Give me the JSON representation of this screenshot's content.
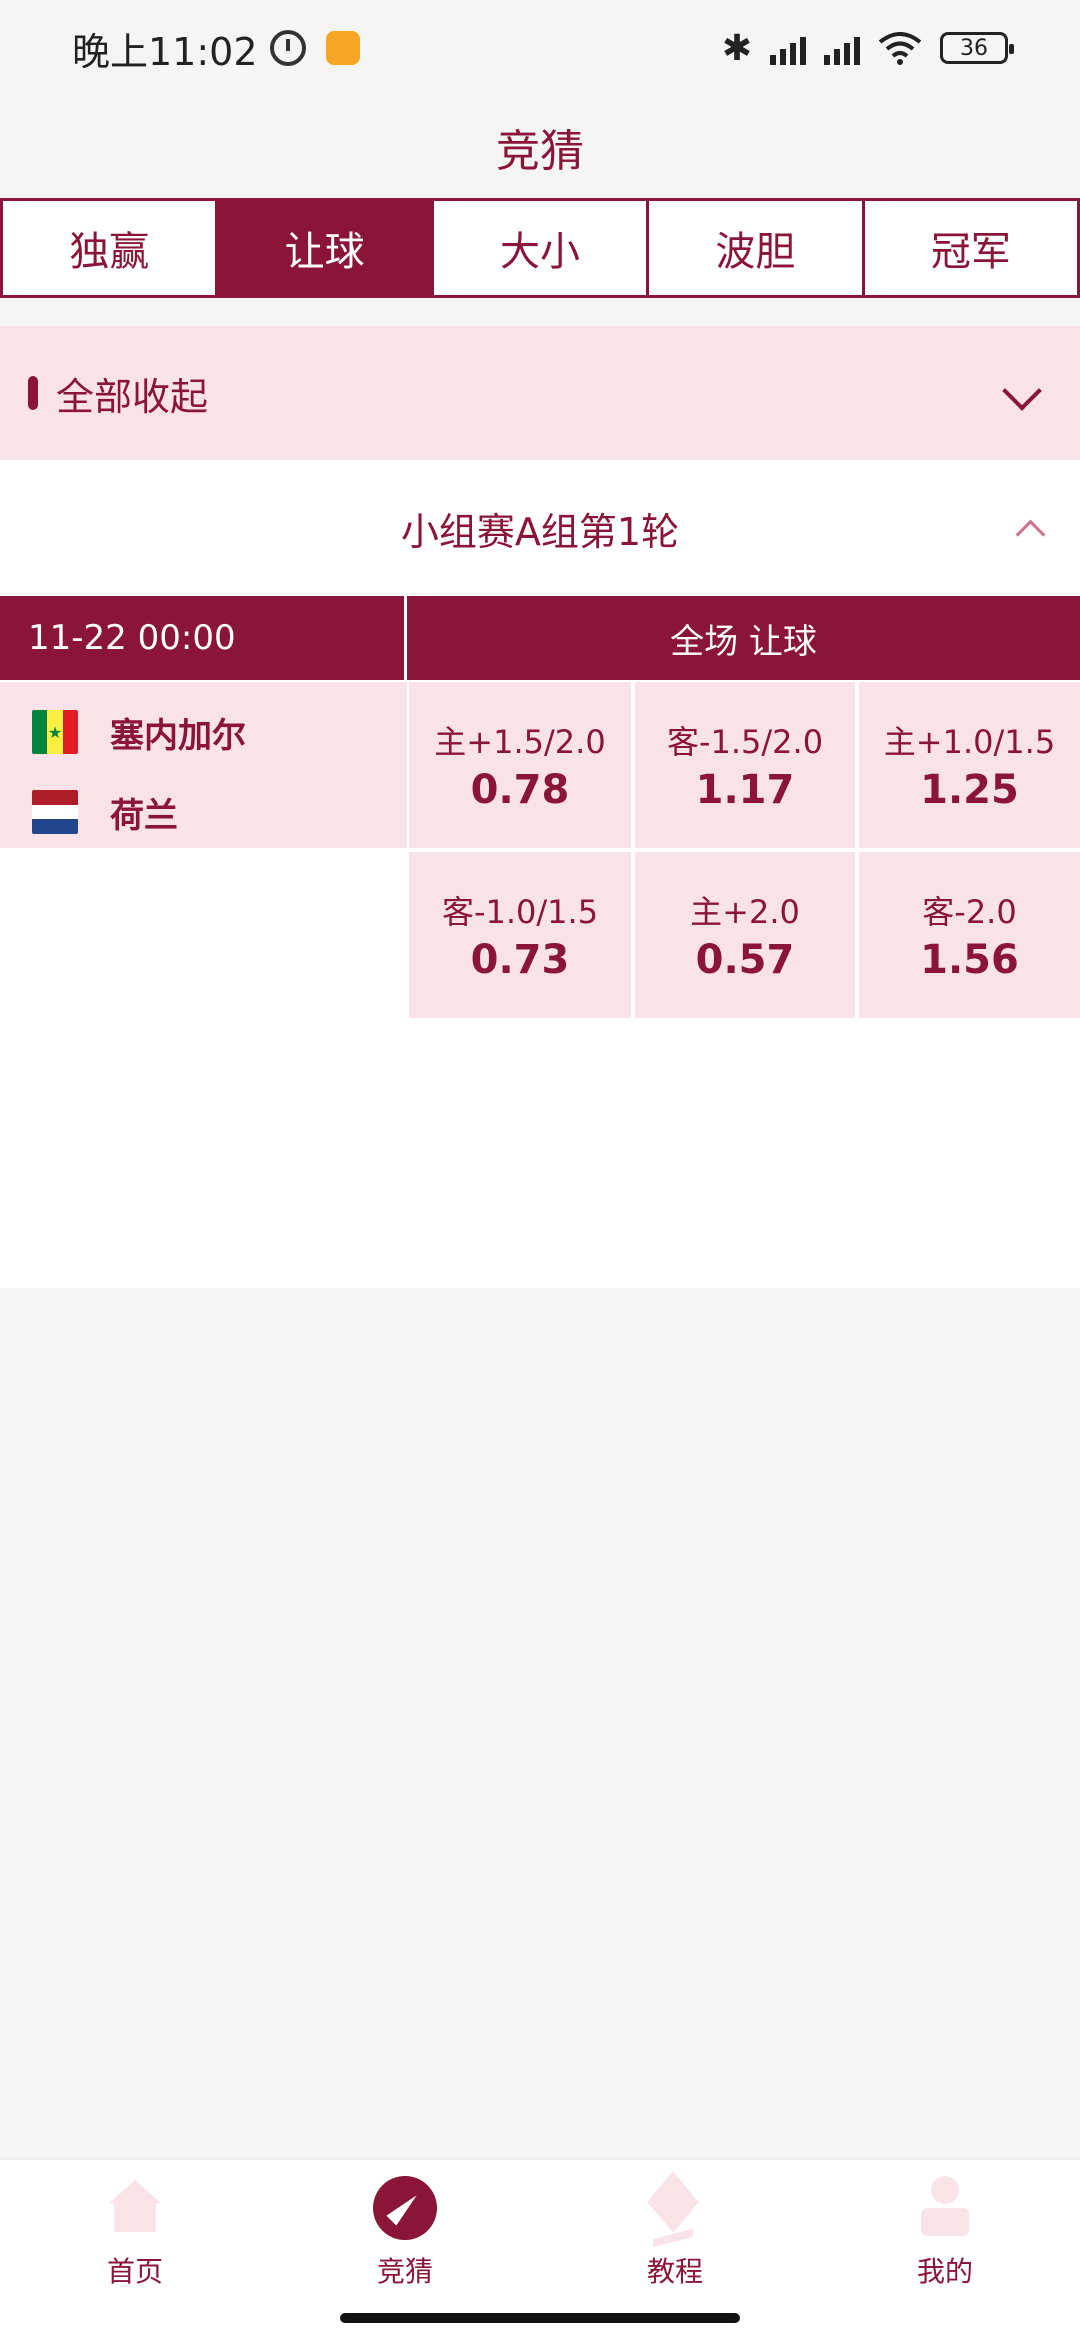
{
  "status_bar": {
    "time": "晚上11:02",
    "battery": "36"
  },
  "header": {
    "title": "竞猜"
  },
  "tabs": [
    {
      "label": "独赢",
      "active": false
    },
    {
      "label": "让球",
      "active": true
    },
    {
      "label": "大小",
      "active": false
    },
    {
      "label": "波胆",
      "active": false
    },
    {
      "label": "冠军",
      "active": false
    }
  ],
  "collapse_bar": {
    "label": "全部收起"
  },
  "round": {
    "title": "小组赛A组第1轮"
  },
  "match": {
    "time": "11-22 00:00",
    "market": "全场 让球",
    "home_team": "塞内加尔",
    "away_team": "荷兰",
    "odds": [
      {
        "label": "主+1.5/2.0",
        "value": "0.78"
      },
      {
        "label": "客-1.5/2.0",
        "value": "1.17"
      },
      {
        "label": "主+1.0/1.5",
        "value": "1.25"
      },
      {
        "label": "客-1.0/1.5",
        "value": "0.73"
      },
      {
        "label": "主+2.0",
        "value": "0.57"
      },
      {
        "label": "客-2.0",
        "value": "1.56"
      }
    ]
  },
  "bottom_nav": [
    {
      "label": "首页",
      "icon": "home-icon"
    },
    {
      "label": "竞猜",
      "icon": "compass-icon"
    },
    {
      "label": "教程",
      "icon": "layers-icon"
    },
    {
      "label": "我的",
      "icon": "user-icon"
    }
  ],
  "colors": {
    "brand": "#8a1538",
    "pink_bg": "#fae3e8"
  }
}
